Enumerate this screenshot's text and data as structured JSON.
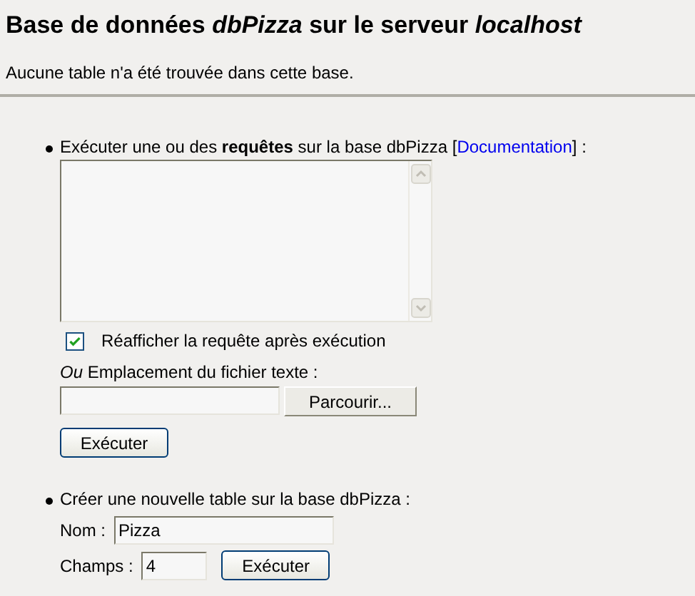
{
  "title": "Base de données *dbPizza* sur le serveur *localhost*",
  "message": "Aucune table n'a été trouvée dans cette base.",
  "query_section": {
    "intro": "Exécuter une ou des **requêtes** sur la base dbPizza [",
    "link": "Documentation",
    "outro": "] :",
    "redisplay": {
      "label": "Réafficher la requête après exécution",
      "checked": true
    },
    "file_label": "*Ou* Emplacement du fichier texte :",
    "browse_button": "Parcourir...",
    "execute_button": "Exécuter"
  },
  "create_section": {
    "intro": "Créer une nouvelle table sur la base dbPizza :",
    "name_label": "Nom :",
    "name_value": "Pizza",
    "fields_label": "Champs :",
    "fields_value": "4",
    "execute_button": "Exécuter"
  }
}
